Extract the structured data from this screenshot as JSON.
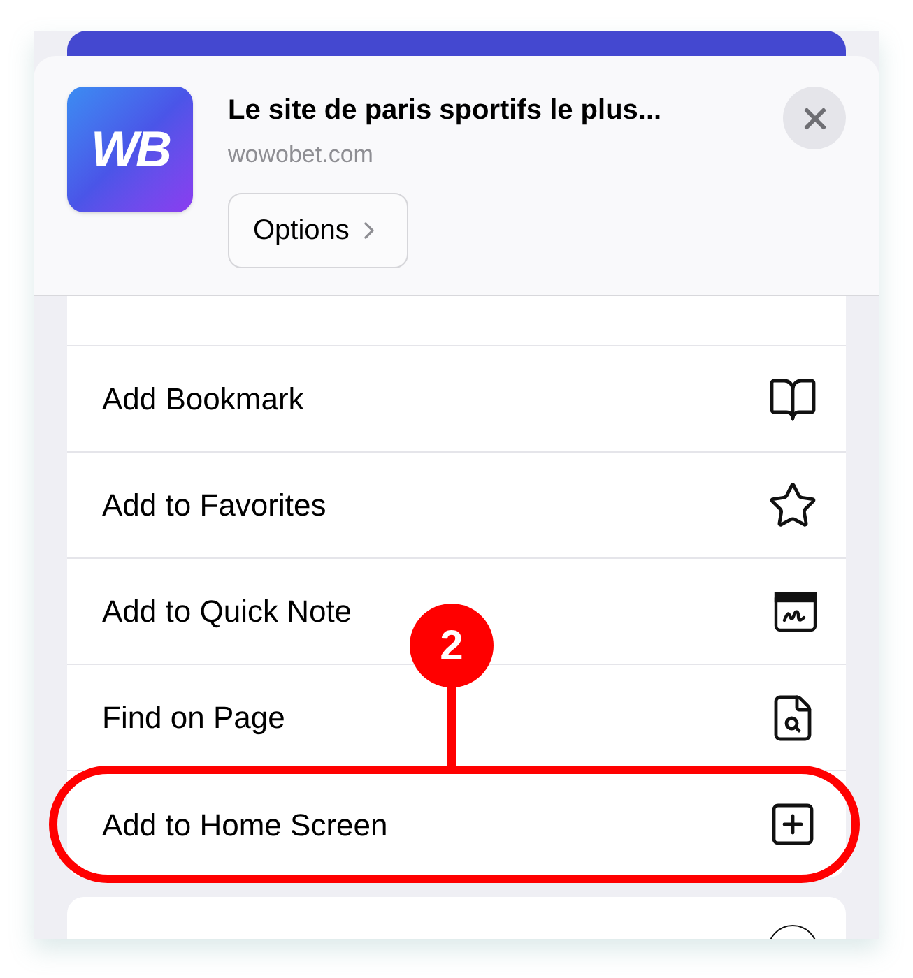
{
  "header": {
    "app_icon_text": "WB",
    "title": "Le site de paris sportifs le plus...",
    "url": "wowobet.com",
    "options_button": "Options"
  },
  "menu": [
    {
      "label": "Add Bookmark",
      "kind": "bookmark",
      "highlighted": false
    },
    {
      "label": "Add to Favorites",
      "kind": "favorites",
      "highlighted": false
    },
    {
      "label": "Add to Quick Note",
      "kind": "quick-note",
      "highlighted": false
    },
    {
      "label": "Find on Page",
      "kind": "find",
      "highlighted": false
    },
    {
      "label": "Add to Home Screen",
      "kind": "home-screen",
      "highlighted": true
    }
  ],
  "callout": {
    "number": "2"
  }
}
